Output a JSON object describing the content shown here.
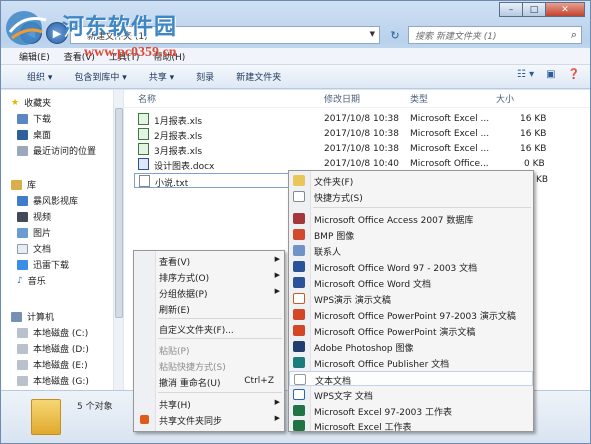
{
  "window": {
    "minimize": "–",
    "maximize": "□",
    "close": "✕"
  },
  "watermark": {
    "site_name": "河东软件园",
    "url": "www.pc0359.cn"
  },
  "address_bar": {
    "path": "新建文件夹 (1)",
    "search_placeholder": "搜索 新建文件夹 (1)"
  },
  "menubar": {
    "items": [
      "编辑(E)",
      "查看(V)",
      "工具(T)",
      "帮助(H)"
    ]
  },
  "toolbar": {
    "organize": "组织 ▾",
    "include_library": "包含到库中 ▾",
    "share": "共享 ▾",
    "burn": "刻录",
    "new_folder": "新建文件夹"
  },
  "nav_pane": {
    "favorites": "收藏夹",
    "downloads": "下载",
    "desktop": "桌面",
    "recent": "最近访问的位置",
    "libraries": "库",
    "storm": "暴风影视库",
    "videos": "视频",
    "pictures": "图片",
    "documents": "文档",
    "xunlei": "迅雷下载",
    "music": "音乐",
    "computer": "计算机",
    "disk_c": "本地磁盘 (C:)",
    "disk_d": "本地磁盘 (D:)",
    "disk_e": "本地磁盘 (E:)",
    "disk_g": "本地磁盘 (G:)"
  },
  "columns": {
    "name": "名称",
    "date": "修改日期",
    "type": "类型",
    "size": "大小"
  },
  "files": [
    {
      "name": "1月报表.xls",
      "date": "2017/10/8 10:38",
      "type": "Microsoft Excel ...",
      "size": "16 KB"
    },
    {
      "name": "2月报表.xls",
      "date": "2017/10/8 10:38",
      "type": "Microsoft Excel ...",
      "size": "16 KB"
    },
    {
      "name": "3月报表.xls",
      "date": "2017/10/8 10:38",
      "type": "Microsoft Excel ...",
      "size": "16 KB"
    },
    {
      "name": "设计图表.docx",
      "date": "2017/10/8 10:40",
      "type": "Microsoft Office...",
      "size": "0 KB"
    },
    {
      "name": "小说.txt",
      "date": "",
      "type": "",
      "size": "KB"
    }
  ],
  "status": {
    "count": "5 个对象"
  },
  "context_menu": {
    "view": "查看(V)",
    "sort": "排序方式(O)",
    "group": "分组依据(P)",
    "refresh": "刷新(E)",
    "customize": "自定义文件夹(F)...",
    "paste": "粘贴(P)",
    "paste_shortcut": "粘贴快捷方式(S)",
    "undo_rename": "撤消 重命名(U)",
    "undo_shortcut": "Ctrl+Z",
    "share_with": "共享(H)",
    "sync": "共享文件夹同步"
  },
  "new_submenu": {
    "folder": "文件夹(F)",
    "shortcut": "快捷方式(S)",
    "access": "Microsoft Office Access 2007 数据库",
    "bmp": "BMP 图像",
    "contact": "联系人",
    "word97": "Microsoft Office Word 97 - 2003 文档",
    "word": "Microsoft Office Word 文档",
    "wps_ppt": "WPS演示 演示文稿",
    "ppt97": "Microsoft Office PowerPoint 97-2003 演示文稿",
    "ppt": "Microsoft Office PowerPoint 演示文稿",
    "psd": "Adobe Photoshop 图像",
    "publisher": "Microsoft Office Publisher 文档",
    "text": "文本文档",
    "wps_doc": "WPS文字 文档",
    "excel97": "Microsoft Excel 97-2003 工作表",
    "excel": "Microsoft Excel 工作表"
  }
}
